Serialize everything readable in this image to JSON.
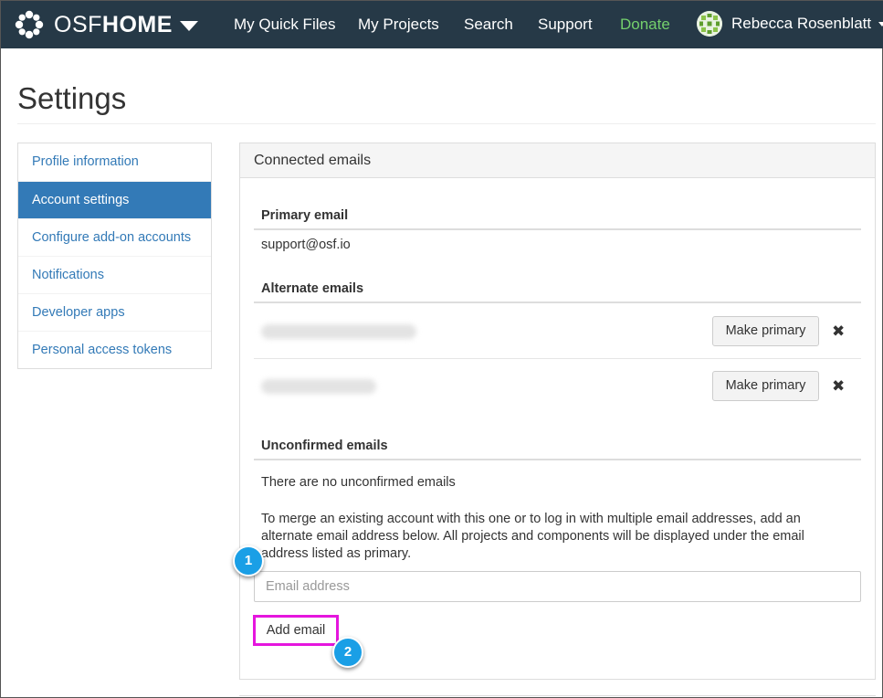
{
  "navbar": {
    "brand_osf": "OSF",
    "brand_home": "HOME",
    "links": [
      "My Quick Files",
      "My Projects",
      "Search",
      "Support",
      "Donate"
    ],
    "user_name": "Rebecca Rosenblatt",
    "donate_color": "#74d06c",
    "bg_color": "#263947"
  },
  "page": {
    "title": "Settings"
  },
  "sidebar": {
    "items": [
      {
        "label": "Profile information",
        "active": false
      },
      {
        "label": "Account settings",
        "active": true
      },
      {
        "label": "Configure add-on accounts",
        "active": false
      },
      {
        "label": "Notifications",
        "active": false
      },
      {
        "label": "Developer apps",
        "active": false
      },
      {
        "label": "Personal access tokens",
        "active": false
      }
    ],
    "active_color": "#337ab7"
  },
  "panel": {
    "heading": "Connected emails",
    "primary_label": "Primary email",
    "primary_email": "support@osf.io",
    "alternate_label": "Alternate emails",
    "make_primary_label": "Make primary",
    "unconfirmed_label": "Unconfirmed emails",
    "unconfirmed_empty": "There are no unconfirmed emails",
    "help_text": "To merge an existing account with this one or to log in with multiple email addresses, add an alternate email address below. All projects and components will be displayed under the email address listed as primary.",
    "email_placeholder": "Email address",
    "add_email_label": "Add email"
  },
  "callouts": {
    "first": "1",
    "second": "2",
    "color": "#1a9fe6",
    "highlight_color": "#e516de"
  }
}
